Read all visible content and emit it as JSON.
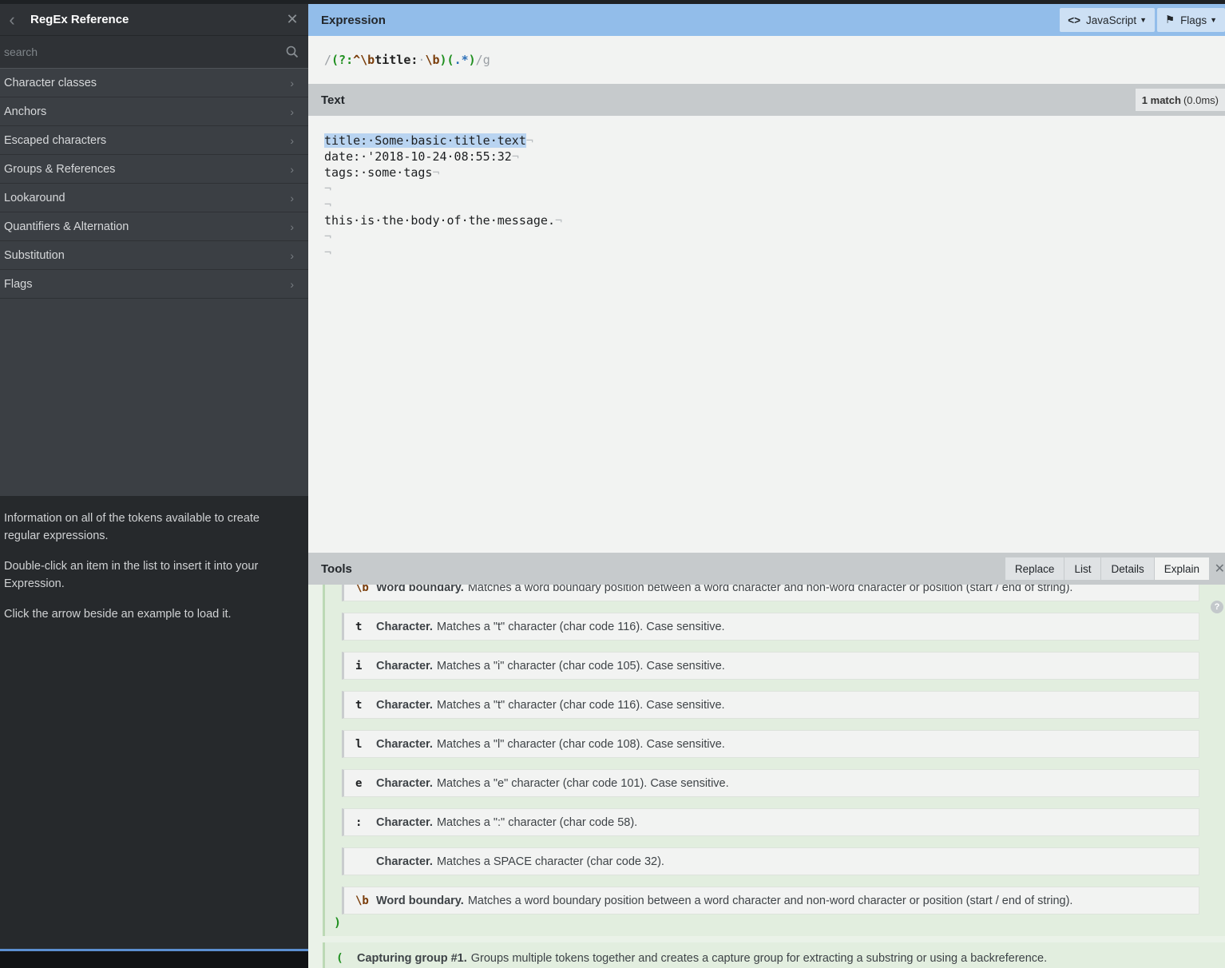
{
  "sidebar": {
    "title": "RegEx Reference",
    "search_placeholder": "search",
    "items": [
      {
        "label": "Character classes"
      },
      {
        "label": "Anchors"
      },
      {
        "label": "Escaped characters"
      },
      {
        "label": "Groups & References"
      },
      {
        "label": "Lookaround"
      },
      {
        "label": "Quantifiers & Alternation"
      },
      {
        "label": "Substitution"
      },
      {
        "label": "Flags"
      }
    ],
    "info": [
      "Information on all of the tokens available to create regular expressions.",
      "Double-click an item in the list to insert it into your Expression.",
      "Click the arrow beside an example to load it."
    ]
  },
  "expression": {
    "title": "Expression",
    "flavor_label": "JavaScript",
    "flags_label": "Flags",
    "regex": {
      "open_slash": "/",
      "group_open": "(?:",
      "caret": "^",
      "esc_b1": "\\b",
      "literal": "title:",
      "esc_b2": "\\b",
      "cap_open": "(",
      "dot": ".",
      "star": "*",
      "cap_close": ")",
      "close_slash": "/",
      "flags": "g"
    }
  },
  "text": {
    "title": "Text",
    "match_count": "1 match",
    "match_time": "(0.0ms)",
    "lines": {
      "l1_hl": "title:·Some·basic·title·text",
      "l1_tail": "¬",
      "l2": "date:·'2018-10-24·08:55:32",
      "l3": "tags:·some·tags",
      "l4": "",
      "l5": "",
      "l6": "this·is·the·body·of·the·message.",
      "l7": "",
      "l8": "",
      "eol": "¬"
    }
  },
  "tools": {
    "title": "Tools",
    "tabs": {
      "replace": "Replace",
      "list": "List",
      "details": "Details",
      "explain": "Explain"
    },
    "rows": [
      {
        "token": "\\b",
        "kind": "Word boundary.",
        "desc": "Matches a word boundary position between a word character and non-word character or position (start / end of string)."
      },
      {
        "token": "t",
        "kind": "Character.",
        "desc": "Matches a \"t\" character (char code 116). Case sensitive."
      },
      {
        "token": "i",
        "kind": "Character.",
        "desc": "Matches a \"i\" character (char code 105). Case sensitive."
      },
      {
        "token": "t",
        "kind": "Character.",
        "desc": "Matches a \"t\" character (char code 116). Case sensitive."
      },
      {
        "token": "l",
        "kind": "Character.",
        "desc": "Matches a \"l\" character (char code 108). Case sensitive."
      },
      {
        "token": "e",
        "kind": "Character.",
        "desc": "Matches a \"e\" character (char code 101). Case sensitive."
      },
      {
        "token": ":",
        "kind": "Character.",
        "desc": "Matches a \":\" character (char code 58)."
      },
      {
        "token": "",
        "kind": "Character.",
        "desc": "Matches a SPACE character (char code 32)."
      },
      {
        "token": "\\b",
        "kind": "Word boundary.",
        "desc": "Matches a word boundary position between a word character and non-word character or position (start / end of string)."
      }
    ],
    "close_paren": ")",
    "capture": {
      "token": "(",
      "kind": "Capturing group #1.",
      "desc": "Groups multiple tokens together and creates a capture group for extracting a substring or using a backreference."
    }
  }
}
